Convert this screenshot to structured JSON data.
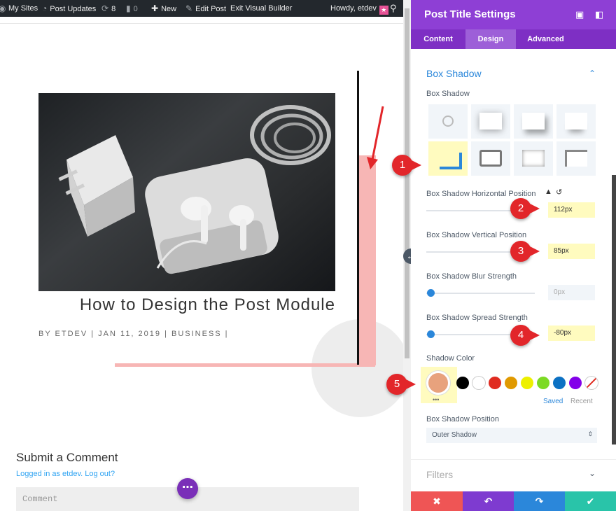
{
  "adminbar": {
    "wp_icon": "wordpress-logo-icon",
    "my_sites": "My Sites",
    "post_updates": "Post Updates",
    "updates_count": "8",
    "comments_count": "0",
    "new": "New",
    "edit_post": "Edit Post",
    "exit_builder": "Exit Visual Builder",
    "howdy": "Howdy, etdev"
  },
  "post": {
    "title": "How to Design the Post Module",
    "meta": "BY ETDEV | JAN 11, 2019 | BUSINESS |"
  },
  "comments": {
    "title": "Submit a Comment",
    "login_text": "Logged in as etdev. Log out?",
    "placeholder": "Comment"
  },
  "panel": {
    "title": "Post Title Settings",
    "tabs": [
      "Content",
      "Design",
      "Advanced"
    ],
    "active_tab": "Design",
    "section_title": "Box Shadow",
    "box_shadow_label": "Box Shadow",
    "horizontal": {
      "label": "Box Shadow Horizontal Position",
      "value": "112px"
    },
    "vertical": {
      "label": "Box Shadow Vertical Position",
      "value": "85px"
    },
    "blur": {
      "label": "Box Shadow Blur Strength",
      "value": "0px"
    },
    "spread": {
      "label": "Box Shadow Spread Strength",
      "value": "-80px"
    },
    "shadow_color_label": "Shadow Color",
    "color_tabs": {
      "saved": "Saved",
      "recent": "Recent"
    },
    "swatches": [
      "#000000",
      "#ffffff",
      "#e02b20",
      "#e09900",
      "#edf000",
      "#7cda24",
      "#0c71c3",
      "#8300e9"
    ],
    "position": {
      "label": "Box Shadow Position",
      "value": "Outer Shadow"
    },
    "filters_title": "Filters"
  },
  "annotations": [
    "1",
    "2",
    "3",
    "4",
    "5"
  ],
  "colors": {
    "accent_purple": "#8e3fd5",
    "link_blue": "#2b87da",
    "shadow_pink": "#f7b6b5",
    "highlight_yellow": "#fffbbf",
    "annotation_red": "#e2262a",
    "footer": [
      "#ef5555",
      "#7e3bd0",
      "#2b87da",
      "#29c4a9"
    ]
  }
}
